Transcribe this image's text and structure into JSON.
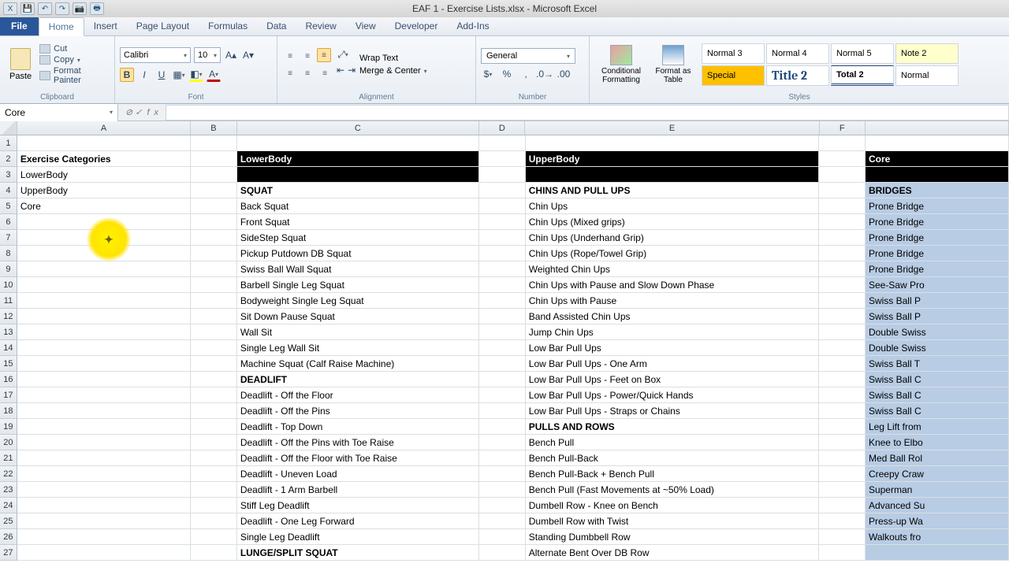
{
  "titlebar": {
    "doc_title": "EAF 1 - Exercise Lists.xlsx - Microsoft Excel"
  },
  "tabs": {
    "file": "File",
    "items": [
      "Home",
      "Insert",
      "Page Layout",
      "Formulas",
      "Data",
      "Review",
      "View",
      "Developer",
      "Add-Ins"
    ],
    "active": "Home"
  },
  "clipboard": {
    "paste": "Paste",
    "cut": "Cut",
    "copy": "Copy",
    "painter": "Format Painter",
    "label": "Clipboard"
  },
  "font": {
    "name": "Calibri",
    "size": "10",
    "bold": "B",
    "italic": "I",
    "underline": "U",
    "label": "Font"
  },
  "alignment": {
    "wrap": "Wrap Text",
    "merge": "Merge & Center",
    "label": "Alignment"
  },
  "number": {
    "format": "General",
    "label": "Number"
  },
  "styles": {
    "cond": "Conditional Formatting",
    "table": "Format as Table",
    "cells": [
      "Normal 3",
      "Normal 4",
      "Normal 5",
      "Note 2",
      "Special",
      "Title 2",
      "Total 2",
      "Normal"
    ],
    "label": "Styles"
  },
  "namebox": "Core",
  "columns": [
    "A",
    "B",
    "C",
    "D",
    "E",
    "F"
  ],
  "grid": {
    "A": [
      "",
      "Exercise Categories",
      "LowerBody",
      "UpperBody",
      "Core",
      "",
      "",
      "",
      "",
      "",
      "",
      "",
      "",
      "",
      "",
      "",
      "",
      "",
      "",
      "",
      "",
      "",
      "",
      "",
      "",
      "",
      ""
    ],
    "C": [
      "",
      "LowerBody",
      "",
      "SQUAT",
      "Back Squat",
      "Front Squat",
      "SideStep Squat",
      "Pickup Putdown DB Squat",
      "Swiss Ball Wall Squat",
      "Barbell Single Leg Squat",
      "Bodyweight Single Leg Squat",
      "Sit Down Pause Squat",
      "Wall Sit",
      "Single Leg Wall Sit",
      "Machine Squat (Calf Raise Machine)",
      "DEADLIFT",
      "Deadlift - Off the Floor",
      "Deadlift - Off the Pins",
      "Deadlift - Top Down",
      "Deadlift - Off the Pins with Toe Raise",
      "Deadlift - Off the Floor with Toe Raise",
      "Deadlift - Uneven Load",
      "Deadlift - 1 Arm Barbell",
      "Stiff Leg Deadlift",
      "Deadlift - One Leg Forward",
      "Single Leg Deadlift",
      "LUNGE/SPLIT SQUAT"
    ],
    "E": [
      "",
      "UpperBody",
      "",
      "CHINS AND PULL UPS",
      "Chin Ups",
      "Chin Ups (Mixed grips)",
      "Chin Ups (Underhand Grip)",
      "Chin Ups (Rope/Towel Grip)",
      "Weighted Chin Ups",
      "Chin Ups with Pause and Slow Down Phase",
      "Chin Ups with Pause",
      "Band Assisted Chin Ups",
      "Jump Chin Ups",
      "Low Bar Pull Ups",
      "Low Bar Pull Ups - One Arm",
      "Low Bar Pull Ups - Feet on Box",
      "Low Bar Pull Ups - Power/Quick Hands",
      "Low Bar Pull Ups - Straps or Chains",
      "PULLS AND ROWS",
      "Bench Pull",
      "Bench Pull-Back",
      "Bench Pull-Back + Bench Pull",
      "Bench Pull (Fast Movements at ~50% Load)",
      "Dumbell Row - Knee on Bench",
      "Dumbell Row with Twist",
      "Standing Dumbbell Row",
      "Alternate Bent Over DB Row"
    ],
    "G": [
      "",
      "Core",
      "",
      "BRIDGES",
      "Prone Bridge",
      "Prone Bridge",
      "Prone Bridge",
      "Prone Bridge",
      "Prone Bridge",
      "See-Saw Pro",
      "Swiss Ball P",
      "Swiss Ball P",
      "Double Swiss",
      "Double Swiss",
      "Swiss Ball T",
      "Swiss Ball C",
      "Swiss Ball C",
      "Swiss Ball C",
      "Leg Lift from",
      "Knee to Elbo",
      "Med Ball Rol",
      "Creepy Craw",
      "Superman",
      "Advanced Su",
      "Press-up Wa",
      "Walkouts fro",
      ""
    ]
  },
  "bold_rows": {
    "A": [
      2
    ],
    "C": [
      4,
      16,
      27
    ],
    "E": [
      4,
      19
    ],
    "G": [
      4
    ]
  }
}
